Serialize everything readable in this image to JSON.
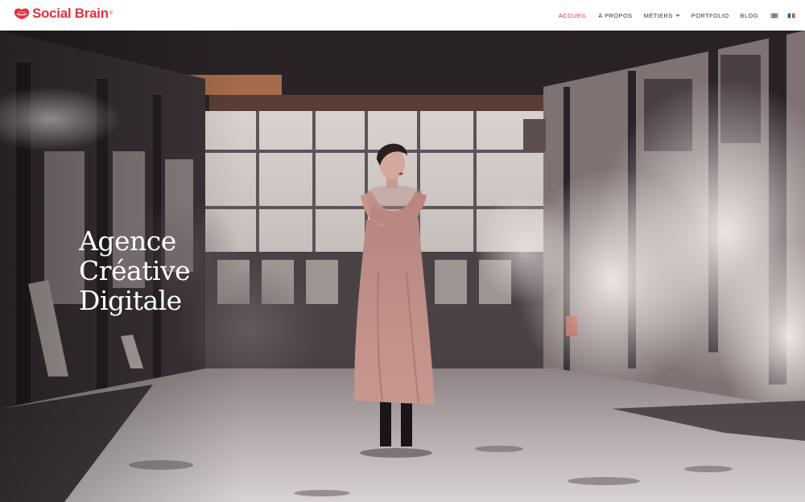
{
  "brand": {
    "name": "Social Brain",
    "registered_mark": "®",
    "color": "#e63140"
  },
  "nav": {
    "items": [
      {
        "label": "ACCUEIL",
        "active": true
      },
      {
        "label": "À PROPOS",
        "active": false
      },
      {
        "label": "MÉTIERS",
        "active": false,
        "has_dropdown": true
      },
      {
        "label": "PORTFOLIO",
        "active": false
      },
      {
        "label": "BLOG",
        "active": false
      }
    ],
    "active_color": "#e63140",
    "languages": [
      {
        "code": "en",
        "icon": "uk-flag-icon"
      },
      {
        "code": "fr",
        "icon": "france-flag-icon"
      }
    ]
  },
  "hero": {
    "title_lines": [
      "Agence",
      "Créative",
      "Digitale"
    ],
    "text_color": "#ffffff"
  }
}
